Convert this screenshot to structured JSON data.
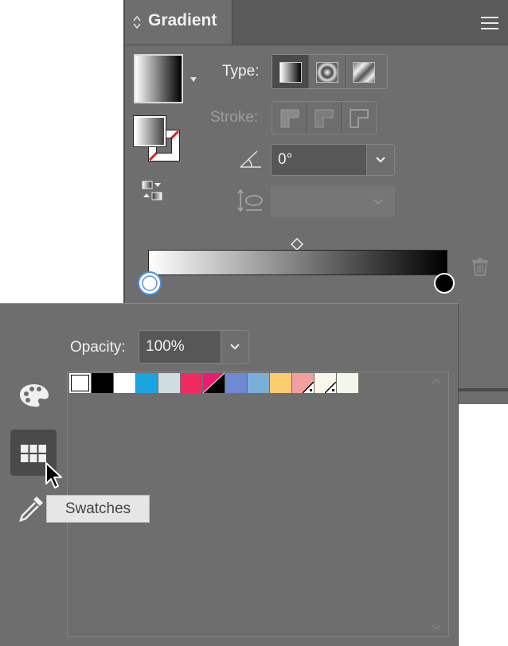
{
  "gradient_panel": {
    "title": "Gradient",
    "type_label": "Type:",
    "stroke_label": "Stroke:",
    "angle_value": "0°",
    "aspect_value": ""
  },
  "swatches_panel": {
    "opacity_label": "Opacity:",
    "opacity_value": "100%",
    "tooltip": "Swatches",
    "swatches": [
      {
        "name": "none",
        "color": "#ffffff"
      },
      {
        "name": "black",
        "color": "#000000"
      },
      {
        "name": "white",
        "color": "#ffffff"
      },
      {
        "name": "cyan",
        "color": "#1aa5e0"
      },
      {
        "name": "light-gray-blue",
        "color": "#cfdde3"
      },
      {
        "name": "magenta-red",
        "color": "#f02a5e"
      },
      {
        "name": "pink-global",
        "color": "#ee1b75"
      },
      {
        "name": "periwinkle",
        "color": "#6e8ad1"
      },
      {
        "name": "sky-blue",
        "color": "#7aafdb"
      },
      {
        "name": "yellow-orange",
        "color": "#fdcc6c"
      },
      {
        "name": "salmon-global",
        "color": "#f29f9f"
      },
      {
        "name": "cream-global",
        "color": "#fbf6ec"
      },
      {
        "name": "mint-white",
        "color": "#f1f7ea"
      }
    ]
  }
}
